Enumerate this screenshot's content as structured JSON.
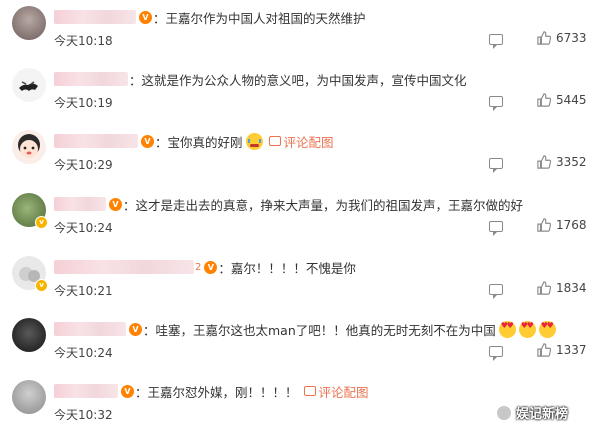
{
  "comments": [
    {
      "text": "：王嘉尔作为中国人对祖国的天然维护",
      "time": "今天10:18",
      "likes": "6733",
      "has_pics": false
    },
    {
      "text": "：这就是作为公众人物的意义吧，为中国发声，宣传中国文化",
      "time": "今天10:19",
      "likes": "5445",
      "has_pics": false
    },
    {
      "text": "：宝你真的好刚",
      "time": "今天10:29",
      "likes": "3352",
      "has_pics": true,
      "pics_label": "评论配图"
    },
    {
      "text": "：这才是走出去的真意，挣来大声量，为我们的祖国发声，王嘉尔做的好",
      "time": "今天10:24",
      "likes": "1768",
      "has_pics": false
    },
    {
      "name_suffix": "2",
      "text": "：嘉尔！！！！不愧是你",
      "time": "今天10:21",
      "likes": "1834",
      "has_pics": false
    },
    {
      "text": "：哇塞，王嘉尔这也太man了吧！！他真的无时无刻不在为中国",
      "time": "今天10:24",
      "likes": "1337",
      "has_pics": false
    },
    {
      "text": "：王嘉尔怼外媒，刚！！！！",
      "time": "今天10:32",
      "likes": "",
      "has_pics": true,
      "pics_label": "评论配图"
    }
  ],
  "watermark": "娱记新榜",
  "icons": {
    "reply": "comment-icon",
    "like": "thumbs-up-icon",
    "vip": "vip-badge-icon"
  }
}
